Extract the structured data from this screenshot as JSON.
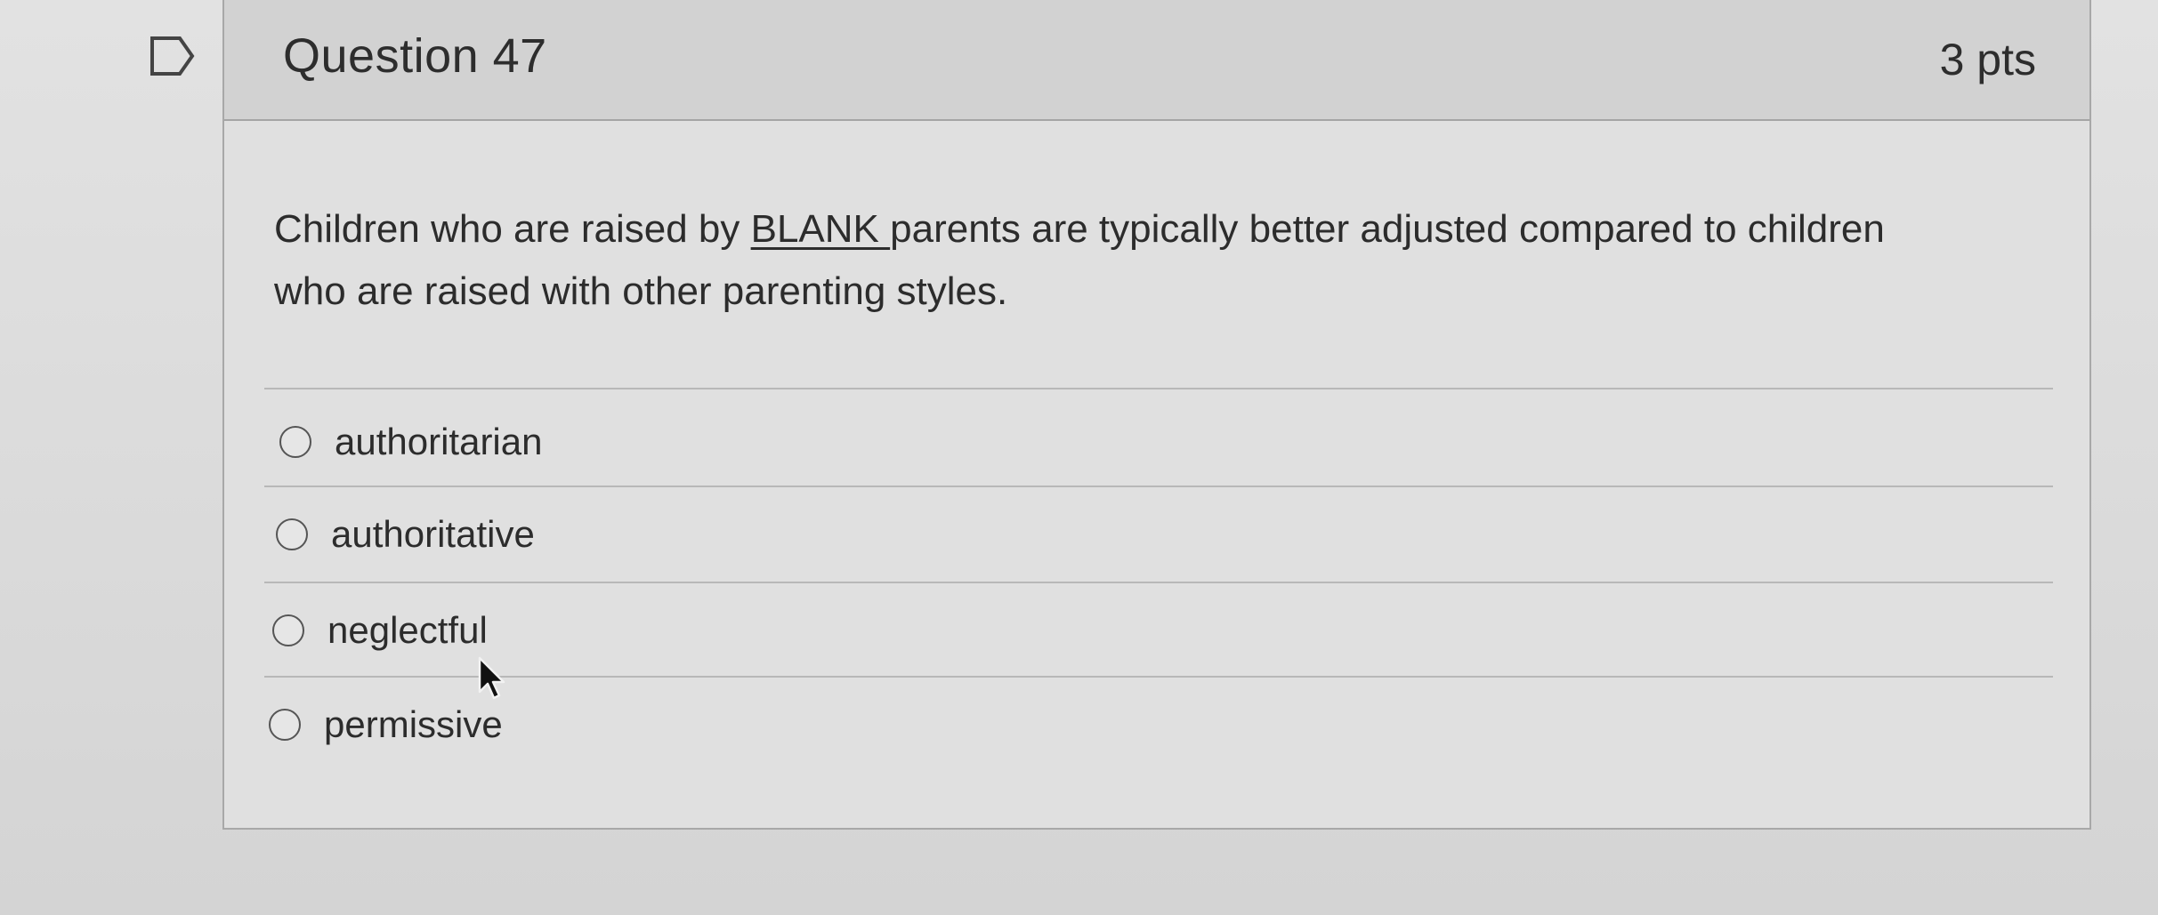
{
  "question": {
    "title": "Question 47",
    "points": "3 pts",
    "text_before": "Children who are raised by ",
    "blank_word": "BLANK ",
    "text_after": "parents are typically better adjusted compared to children who are raised with other parenting styles."
  },
  "answers": [
    {
      "label": "authoritarian",
      "selected": false
    },
    {
      "label": "authoritative",
      "selected": false
    },
    {
      "label": "neglectful",
      "selected": false
    },
    {
      "label": "permissive",
      "selected": false
    }
  ],
  "icons": {
    "flag": "bookmark-flag-icon",
    "radio": "radio-button-icon",
    "cursor": "mouse-pointer-icon"
  }
}
